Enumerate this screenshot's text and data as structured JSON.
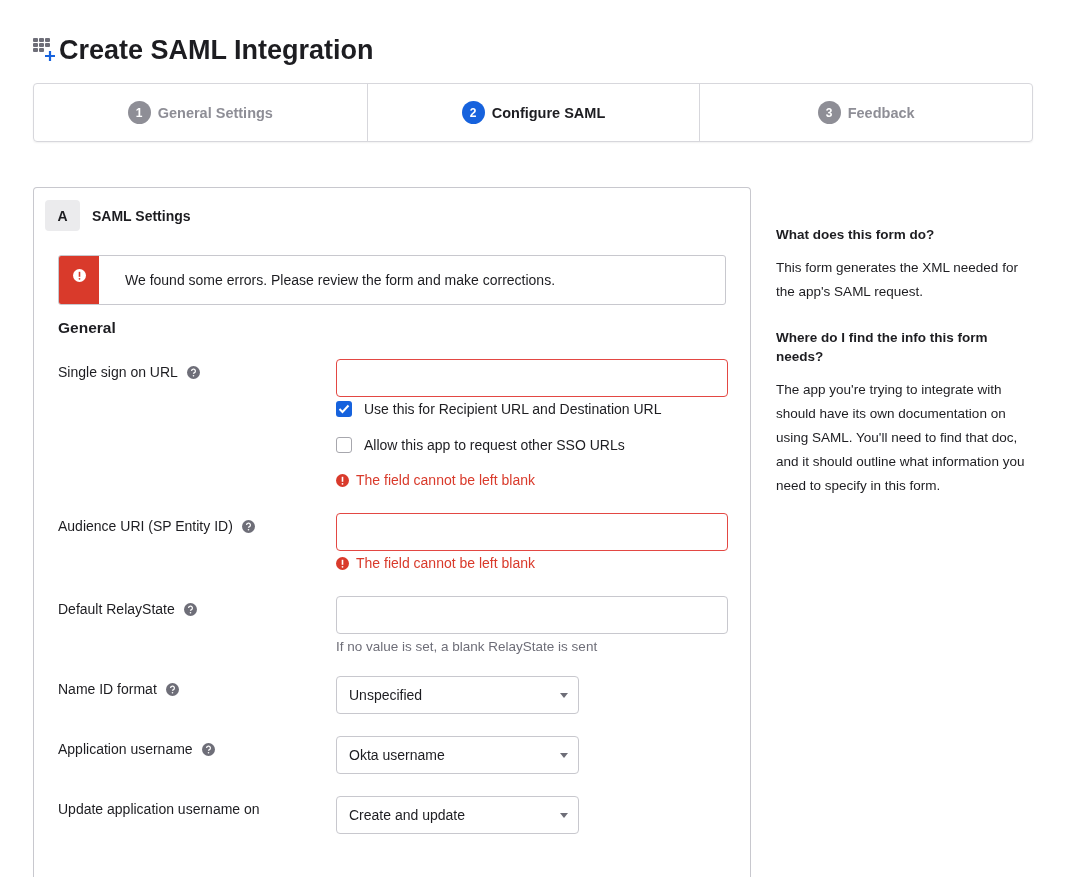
{
  "title": "Create SAML Integration",
  "steps": [
    {
      "number": "1",
      "label": "General Settings",
      "selected": false
    },
    {
      "number": "2",
      "label": "Configure SAML",
      "selected": true
    },
    {
      "number": "3",
      "label": "Feedback",
      "selected": false
    }
  ],
  "section": {
    "letter": "A",
    "title": "SAML Settings"
  },
  "alert": {
    "message": "We found some errors. Please review the form and make corrections."
  },
  "group_title": "General",
  "fields": [
    {
      "kind": "text",
      "label": "Single sign on URL",
      "help": true,
      "error": true,
      "checkboxes": [
        {
          "label": "Use this for Recipient URL and Destination URL",
          "checked": true
        },
        {
          "label": "Allow this app to request other SSO URLs",
          "checked": false
        }
      ],
      "error_text": "The field cannot be left blank"
    },
    {
      "kind": "text",
      "label": "Audience URI (SP Entity ID)",
      "help": true,
      "error": true,
      "error_text": "The field cannot be left blank"
    },
    {
      "kind": "text",
      "label": "Default RelayState",
      "help": true,
      "error": false,
      "hint": "If no value is set, a blank RelayState is sent"
    },
    {
      "kind": "select",
      "label": "Name ID format",
      "help": true,
      "value": "Unspecified"
    },
    {
      "kind": "select",
      "label": "Application username",
      "help": true,
      "value": "Okta username"
    },
    {
      "kind": "select",
      "label": "Update application username on",
      "help": false,
      "value": "Create and update"
    }
  ],
  "sidebar": [
    {
      "heading": "What does this form do?",
      "text": "This form generates the XML needed for the app's SAML request."
    },
    {
      "heading": "Where do I find the info this form needs?",
      "text": "The app you're trying to integrate with should have its own documentation on using SAML. You'll need to find that doc, and it should outline what information you need to specify in this form."
    }
  ]
}
